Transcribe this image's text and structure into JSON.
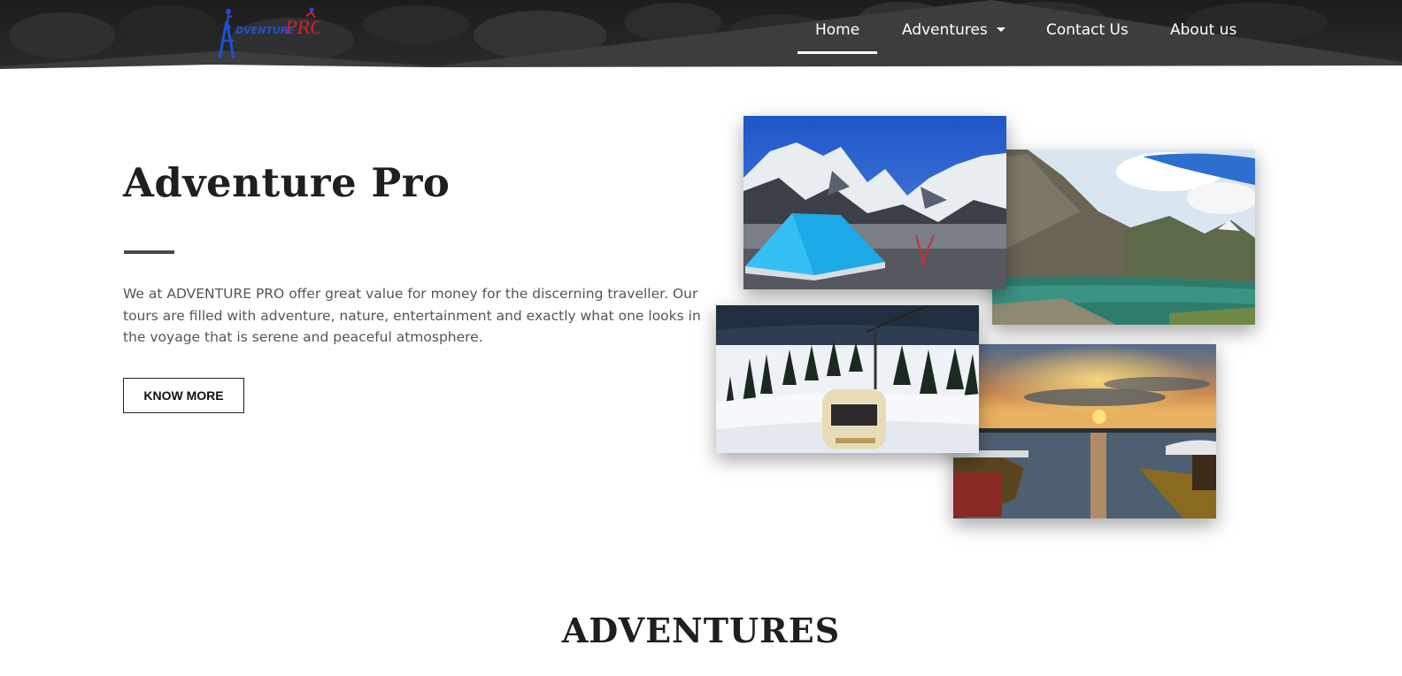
{
  "header": {
    "logo_text_main": "DVENTURE",
    "logo_text_pro": "PRO"
  },
  "nav": {
    "items": [
      {
        "label": "Home",
        "active": true
      },
      {
        "label": "Adventures",
        "dropdown": true
      },
      {
        "label": "Contact Us"
      },
      {
        "label": "About us"
      }
    ]
  },
  "hero": {
    "title": "Adventure Pro",
    "description": "We at ADVENTURE PRO offer great value for money for the discerning traveller. Our tours are filled with adventure, nature, entertainment and exactly what one looks in the voyage that is serene and peaceful atmosphere.",
    "button_label": "KNOW MORE"
  },
  "gallery": {
    "photos": [
      "tent-by-snowy-mountains",
      "mountain-lake",
      "gondola-in-snow",
      "lake-sunset-with-boats"
    ]
  },
  "adventures_section": {
    "title": "ADVENTURES"
  },
  "colors": {
    "header_band": "#3d3d3d",
    "logo_blue": "#1f4fd6",
    "logo_red": "#d81f2a",
    "text_dark": "#1f1f1f",
    "text_body": "#555555"
  }
}
